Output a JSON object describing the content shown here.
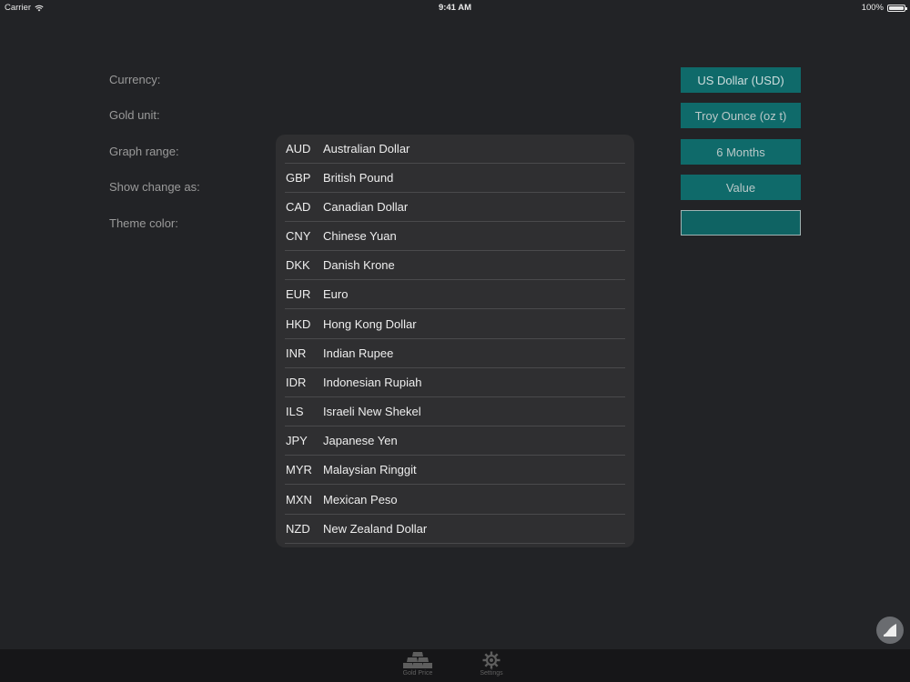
{
  "status_bar": {
    "carrier": "Carrier",
    "time": "9:41 AM",
    "battery": "100%"
  },
  "settings": {
    "currency_label": "Currency:",
    "gold_unit_label": "Gold unit:",
    "graph_range_label": "Graph range:",
    "show_change_label": "Show change as:",
    "theme_color_label": "Theme color:",
    "currency_value": "US Dollar (USD)",
    "gold_unit_value": "Troy Ounce (oz t)",
    "graph_range_value": "6 Months",
    "show_change_value": "Value",
    "theme_color_value": "#0f6363"
  },
  "currency_list": [
    {
      "code": "AUD",
      "name": "Australian Dollar"
    },
    {
      "code": "GBP",
      "name": "British Pound"
    },
    {
      "code": "CAD",
      "name": "Canadian Dollar"
    },
    {
      "code": "CNY",
      "name": "Chinese Yuan"
    },
    {
      "code": "DKK",
      "name": "Danish Krone"
    },
    {
      "code": "EUR",
      "name": "Euro"
    },
    {
      "code": "HKD",
      "name": "Hong Kong Dollar"
    },
    {
      "code": "INR",
      "name": "Indian Rupee"
    },
    {
      "code": "IDR",
      "name": "Indonesian Rupiah"
    },
    {
      "code": "ILS",
      "name": "Israeli New Shekel"
    },
    {
      "code": "JPY",
      "name": "Japanese Yen"
    },
    {
      "code": "MYR",
      "name": "Malaysian Ringgit"
    },
    {
      "code": "MXN",
      "name": "Mexican Peso"
    },
    {
      "code": "NZD",
      "name": "New Zealand Dollar"
    }
  ],
  "tab_bar": {
    "gold_price_label": "Gold Price",
    "settings_label": "Settings",
    "gold_price_icon": "gold-bars-icon",
    "settings_icon": "gear-icon"
  },
  "colors": {
    "accent": "#0f6a6a",
    "background": "#222326",
    "popover": "#2f2f31"
  }
}
